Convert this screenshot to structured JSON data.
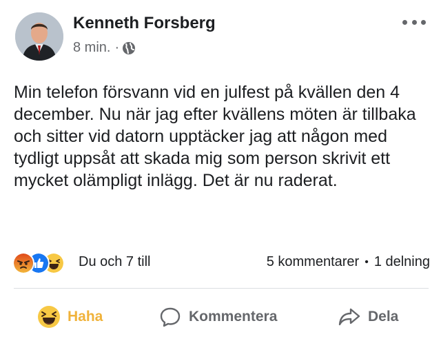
{
  "post": {
    "author": "Kenneth Forsberg",
    "time": "8 min.",
    "meta_separator": "·",
    "audience_icon": "globe-icon",
    "text": "Min telefon försvann vid en julfest på kvällen den 4 december. Nu när jag efter kvällens möten är tillbaka och sitter vid datorn upptäcker jag att någon med tydligt uppsåt att skada mig som person skrivit ett mycket olämpligt inlägg. Det är nu raderat."
  },
  "reactions": {
    "icons": [
      "angry-icon",
      "like-icon",
      "haha-icon"
    ],
    "summary": "Du och 7 till",
    "comments": "5 kommentarer",
    "separator": "•",
    "shares": "1 delning"
  },
  "actions": {
    "react_label": "Haha",
    "comment_label": "Kommentera",
    "share_label": "Dela"
  },
  "colors": {
    "text": "#1c1e21",
    "secondary": "#65676b",
    "haha_active": "#f0b23a",
    "like_blue": "#1877f2",
    "angry": "#e9710f",
    "divider": "#dadde1"
  }
}
